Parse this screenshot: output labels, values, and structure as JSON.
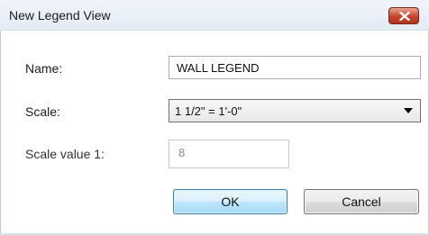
{
  "window": {
    "title": "New Legend View",
    "close_icon": "close-icon"
  },
  "form": {
    "name_label": "Name:",
    "name_value": "WALL LEGEND",
    "scale_label": "Scale:",
    "scale_selected": "1 1/2\" = 1'-0\"",
    "scale_value_label": "Scale value  1:",
    "scale_value": "8"
  },
  "buttons": {
    "ok_label": "OK",
    "cancel_label": "Cancel"
  },
  "colors": {
    "close_button": "#c7432c",
    "default_button_border": "#3c7fb1"
  }
}
